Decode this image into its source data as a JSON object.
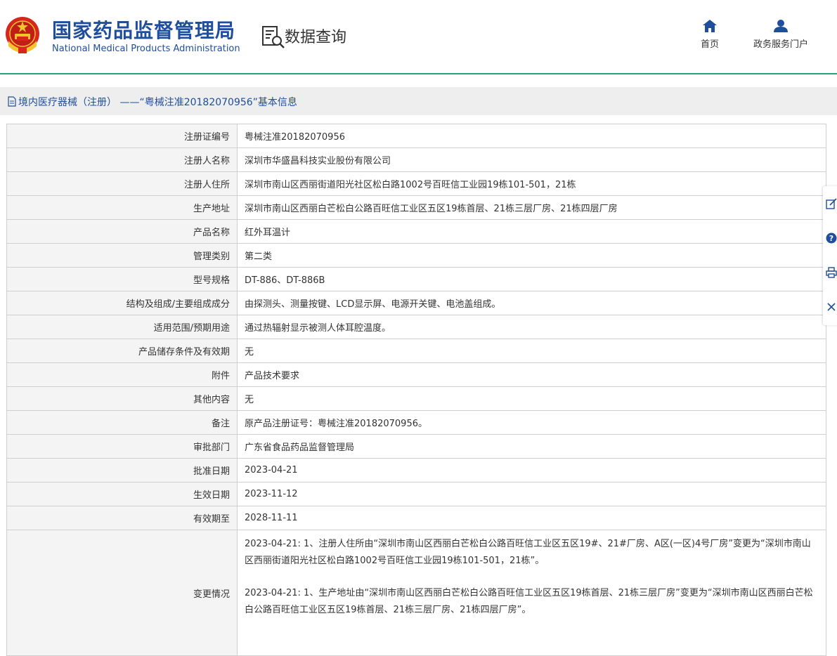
{
  "header": {
    "site_title_cn": "国家药品监督管理局",
    "site_title_en": "National Medical Products Administration",
    "section_title": "数据查询",
    "nav": [
      {
        "label": "首页",
        "icon": "home-icon"
      },
      {
        "label": "政务服务门户",
        "icon": "user-icon"
      }
    ],
    "accent_color": "#1f4e9c",
    "line_color": "#27a37b"
  },
  "title_bar": {
    "text": "境内医疗器械（注册）  ——“粤械注准20182070956”基本信息"
  },
  "rows": [
    {
      "label": "注册证编号",
      "value": "粤械注准20182070956"
    },
    {
      "label": "注册人名称",
      "value": "深圳市华盛昌科技实业股份有限公司"
    },
    {
      "label": "注册人住所",
      "value": "深圳市南山区西丽街道阳光社区松白路1002号百旺信工业园19栋101-501，21栋"
    },
    {
      "label": "生产地址",
      "value": "深圳市南山区西丽白芒松白公路百旺信工业区五区19栋首层、21栋三层厂房、21栋四层厂房"
    },
    {
      "label": "产品名称",
      "value": "红外耳温计"
    },
    {
      "label": "管理类别",
      "value": "第二类"
    },
    {
      "label": "型号规格",
      "value": "DT-886、DT-886B"
    },
    {
      "label": "结构及组成/主要组成成分",
      "value": "由探测头、测量按键、LCD显示屏、电源开关键、电池盖组成。"
    },
    {
      "label": "适用范围/预期用途",
      "value": "通过热辐射显示被测人体耳腔温度。"
    },
    {
      "label": "产品储存条件及有效期",
      "value": "无"
    },
    {
      "label": "附件",
      "value": "产品技术要求"
    },
    {
      "label": "其他内容",
      "value": "无"
    },
    {
      "label": "备注",
      "value": "原产品注册证号：粤械注准20182070956。"
    },
    {
      "label": "审批部门",
      "value": "广东省食品药品监督管理局"
    },
    {
      "label": "批准日期",
      "value": "2023-04-21"
    },
    {
      "label": "生效日期",
      "value": "2023-11-12"
    },
    {
      "label": "有效期至",
      "value": "2028-11-11"
    }
  ],
  "changes": {
    "label": "变更情况",
    "items": [
      "2023-04-21: 1、注册人住所由“深圳市南山区西丽白芒松白公路百旺信工业区五区19#、21#厂房、A区(一区)4号厂房”变更为“深圳市南山区西丽街道阳光社区松白路1002号百旺信工业园19栋101-501，21栋”。",
      "2023-04-21: 1、生产地址由“深圳市南山区西丽白芒松白公路百旺信工业区五区19栋首层、21栋三层厂房”变更为“深圳市南山区西丽白芒松白公路百旺信工业区五区19栋首层、21栋三层厂房、21栋四层厂房”。"
    ]
  },
  "float_tools": [
    "edit-icon",
    "help-icon",
    "print-icon",
    "close-icon"
  ]
}
